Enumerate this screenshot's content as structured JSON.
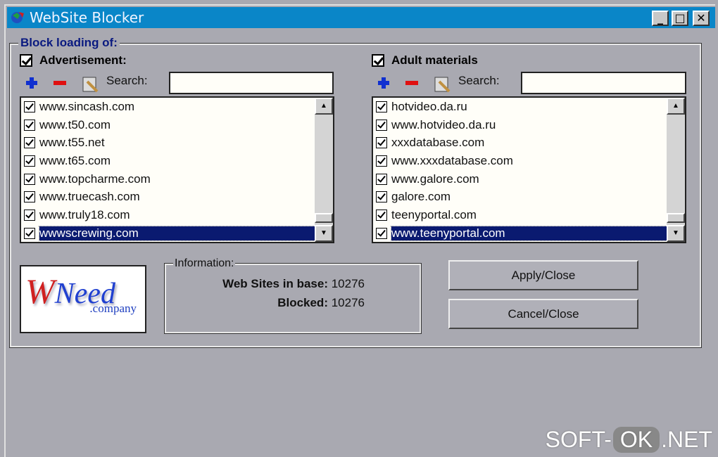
{
  "window": {
    "title": "WebSite Blocker",
    "minimize": "_",
    "maximize": "□",
    "close": "✕"
  },
  "group_title": "Block loading of:",
  "left": {
    "category": "Advertisement:",
    "checked": true,
    "search_label": "Search:",
    "search_value": "",
    "items": [
      "www.sincash.com",
      "www.t50.com",
      "www.t55.net",
      "www.t65.com",
      "www.topcharme.com",
      "www.truecash.com",
      "www.truly18.com",
      "wwwscrewing.com"
    ],
    "selected_index": 7
  },
  "right": {
    "category": "Adult materials",
    "checked": true,
    "search_label": "Search:",
    "search_value": "",
    "items": [
      "hotvideo.da.ru",
      "www.hotvideo.da.ru",
      "xxxdatabase.com",
      "www.xxxdatabase.com",
      "www.galore.com",
      "galore.com",
      "teenyportal.com",
      "www.teenyportal.com"
    ],
    "selected_index": 7
  },
  "logo": {
    "text": "WNeed",
    "sub": ".company"
  },
  "info": {
    "title": "Information:",
    "sites_label": "Web Sites in base:",
    "sites_value": "10276",
    "blocked_label": "Blocked:",
    "blocked_value": "10276"
  },
  "buttons": {
    "apply": "Apply/Close",
    "cancel": "Cancel/Close"
  },
  "watermark": {
    "a": "SOFT-",
    "b": "OK",
    "c": ".NET"
  },
  "colors": {
    "titlebar": "#0a86c8",
    "selection": "#0a1a70",
    "legend": "#0a1a80"
  }
}
